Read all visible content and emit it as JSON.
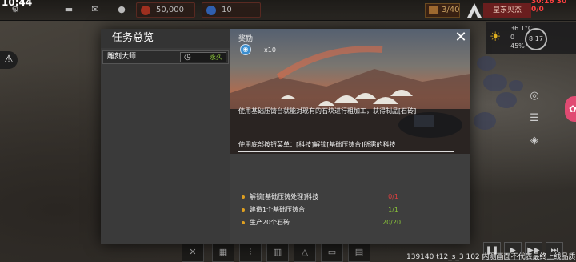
{
  "topbar": {
    "time": "10:44",
    "wood": "50,000",
    "gems": "10",
    "population": "3/40",
    "player_name": "皇东贝杰",
    "clock": "30:16 30 0/0"
  },
  "weather": {
    "temp": "36.1°C",
    "wind": "0",
    "humidity": "45%",
    "compass": "8:17"
  },
  "dialog": {
    "title": "任务总览",
    "tasks": [
      {
        "name": "雕刻大师",
        "status": "永久"
      }
    ],
    "reward_label": "奖励:",
    "reward_qty": "x10",
    "description": "使用基础压铸台就能对现有的石块进行粗加工，获得制品[石砖]",
    "hint": "使用底部按钮菜单：[科技]解锁[基础压铸台]所需的科技",
    "conditions": [
      {
        "text": "解锁[基础压铸处理]科技",
        "value": "0/1",
        "color": "#e04040"
      },
      {
        "text": "建造1个基础压铸台",
        "value": "1/1",
        "color": "#8ac33a"
      },
      {
        "text": "生产20个石砖",
        "value": "20/20",
        "color": "#8ac33a"
      }
    ],
    "close_label": "✕"
  },
  "bottom": {
    "version": "139140 t12_s_3 102 内测画面不代表最终上线品质"
  },
  "colors": {
    "accent": "#8ac33a",
    "alert": "#e04040",
    "pink": "#e04a72"
  }
}
